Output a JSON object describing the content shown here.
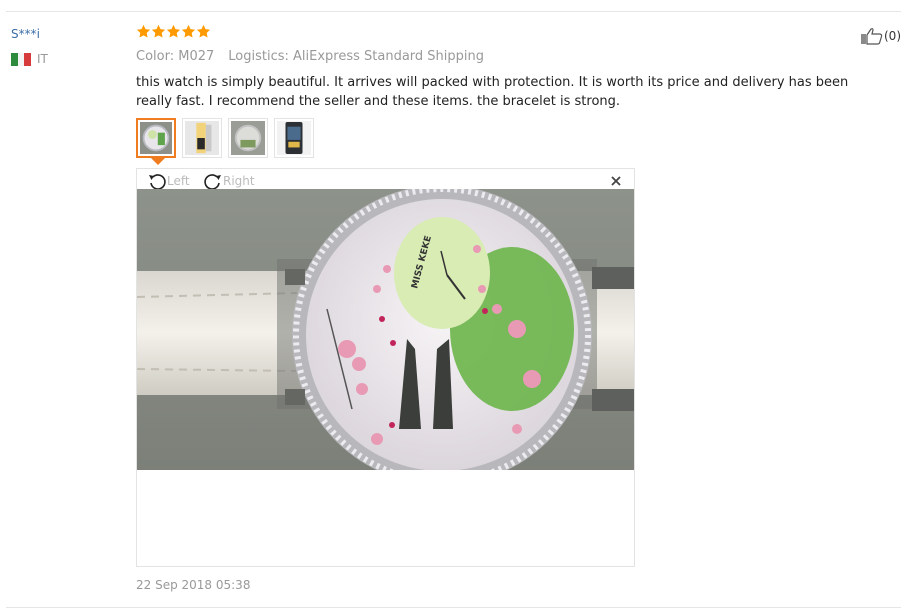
{
  "review": {
    "user": "S***i",
    "country": "IT",
    "rating": 5,
    "stars": [
      1,
      2,
      3,
      4,
      5
    ],
    "color_label": "Color: M027",
    "logistics_label": "Logistics: AliExpress Standard Shipping",
    "text": "this watch is simply beautiful. It arrives will packed with protection. It is worth its price and delivery has been really fast. I recommend the seller and these items. the bracelet is strong.",
    "helpful_count": "(0)",
    "date": "22 Sep 2018 05:38"
  },
  "viewer": {
    "rotate_left_label": "Left",
    "rotate_right_label": "Right",
    "watch_brand": "MISS KEKE"
  },
  "colors": {
    "star": "#ff9a00",
    "accent": "#f07c20",
    "link": "#3b6ea8",
    "muted": "#999999"
  },
  "icons": [
    "star-icon",
    "thumbs-up-icon",
    "rotate-left-icon",
    "rotate-right-icon",
    "close-icon",
    "flag-italy-icon"
  ]
}
